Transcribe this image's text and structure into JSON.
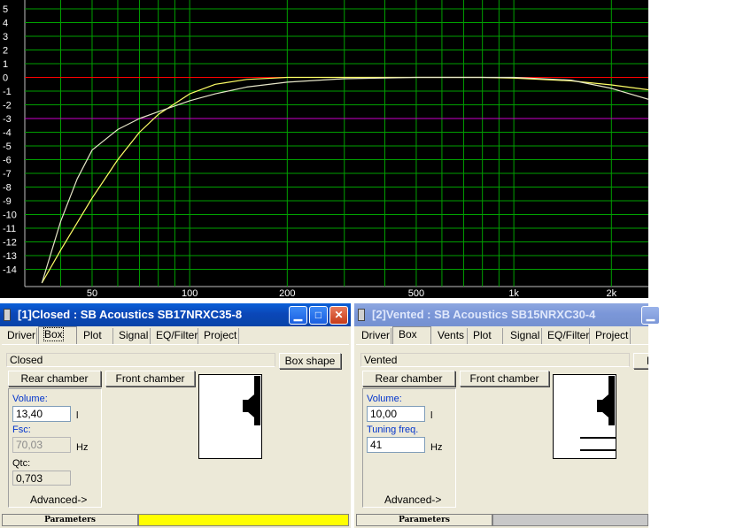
{
  "plot": {
    "y_ticks": [
      "5",
      "4",
      "3",
      "2",
      "1",
      "0",
      "-1",
      "-2",
      "-3",
      "-4",
      "-5",
      "-6",
      "-7",
      "-8",
      "-9",
      "-10",
      "-11",
      "-12",
      "-13",
      "-14"
    ],
    "x_ticks": [
      "50",
      "100",
      "200",
      "500",
      "1k",
      "2k"
    ],
    "colors": {
      "background": "#000000",
      "grid": "#00a000",
      "zero_line": "#ff0000",
      "minus3_line": "#cc00cc",
      "curve_closed": "#ffff66",
      "curve_vented": "#e6e6c8"
    }
  },
  "chart_data": {
    "type": "line",
    "title": "",
    "xlabel": "",
    "ylabel": "",
    "xscale": "log",
    "xlim": [
      31,
      2600
    ],
    "ylim": [
      -15,
      5.5
    ],
    "grid": true,
    "reference_lines": [
      0,
      -3
    ],
    "series": [
      {
        "color": "#ffff66",
        "x": [
          35,
          40,
          50,
          60,
          70,
          80,
          100,
          120,
          150,
          200,
          300,
          500,
          800,
          1000,
          1500,
          2000,
          2600
        ],
        "y": [
          -15,
          -12.6,
          -8.8,
          -6,
          -4,
          -2.7,
          -1.2,
          -0.5,
          -0.15,
          0,
          0,
          0,
          0,
          -0.05,
          -0.25,
          -0.55,
          -0.9
        ]
      },
      {
        "color": "#e6e6c8",
        "x": [
          35,
          40,
          45,
          50,
          60,
          70,
          80,
          100,
          120,
          150,
          200,
          300,
          500,
          800,
          1000,
          1500,
          2000,
          2600
        ],
        "y": [
          -15,
          -10.5,
          -7.4,
          -5.3,
          -3.8,
          -3,
          -2.5,
          -1.7,
          -1.2,
          -0.7,
          -0.35,
          -0.1,
          0,
          0,
          0,
          -0.2,
          -0.8,
          -1.6
        ]
      }
    ]
  },
  "window1": {
    "title": "[1]Closed : SB Acoustics SB17NRXC35-8",
    "tabs": [
      "Driver",
      "Box",
      "Plot",
      "Signal",
      "EQ/Filter",
      "Project"
    ],
    "selected_tab": "Box",
    "box_type": "Closed",
    "box_shape_button": "Box shape",
    "rear_chamber_button": "Rear chamber",
    "front_chamber_button": "Front chamber",
    "volume_label": "Volume:",
    "volume_value": "13,40",
    "volume_unit": "l",
    "fsc_label": "Fsc:",
    "fsc_value": "70,03",
    "fsc_unit": "Hz",
    "qtc_label": "Qtc:",
    "qtc_value": "0,703",
    "advanced_button": "Advanced->",
    "status_label": "Parameters",
    "status_color": "#ffff00"
  },
  "window2": {
    "title": "[2]Vented : SB Acoustics SB15NRXC30-4",
    "tabs": [
      "Driver",
      "Box",
      "Vents",
      "Plot",
      "Signal",
      "EQ/Filter",
      "Project"
    ],
    "selected_tab": "Box",
    "box_type": "Vented",
    "box_shape_button_partial": "B",
    "rear_chamber_button": "Rear chamber",
    "front_chamber_button": "Front chamber",
    "volume_label": "Volume:",
    "volume_value": "10,00",
    "volume_unit": "l",
    "tuning_label": "Tuning freq.",
    "tuning_value": "41",
    "tuning_unit": "Hz",
    "advanced_button": "Advanced->",
    "status_label": "Parameters",
    "status_color": "#c8c8c8"
  }
}
